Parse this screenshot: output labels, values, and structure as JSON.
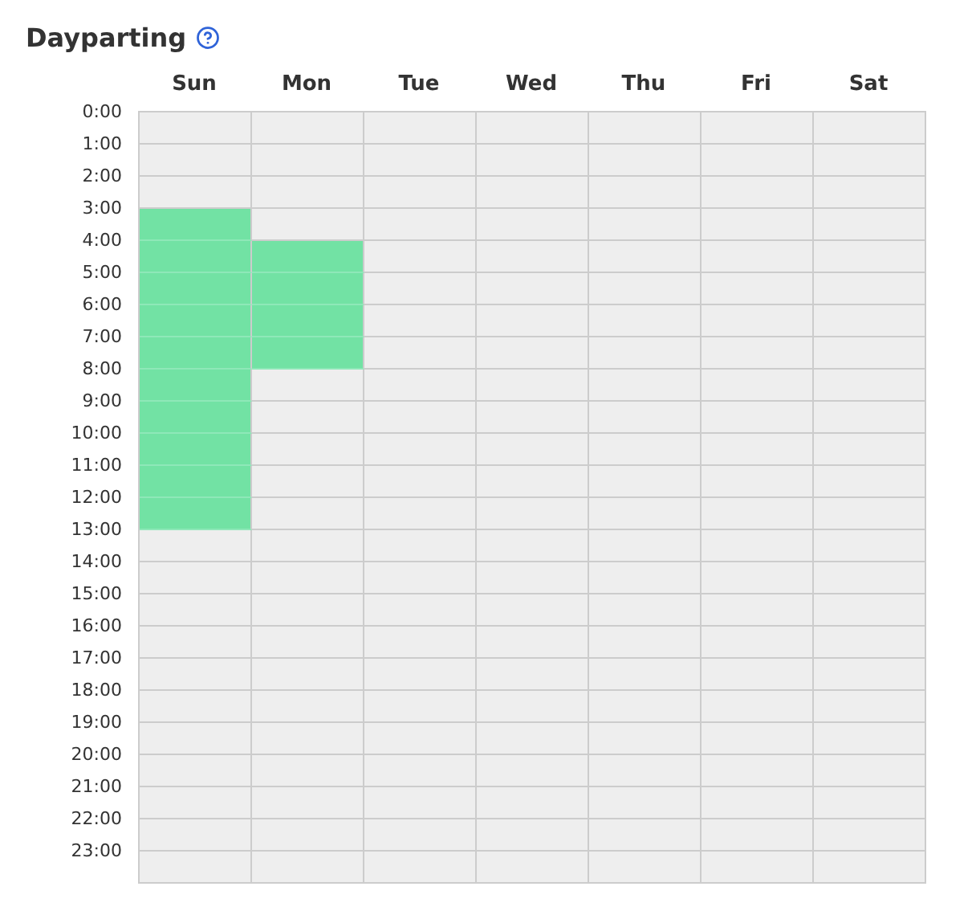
{
  "title": "Dayparting",
  "days": [
    "Sun",
    "Mon",
    "Tue",
    "Wed",
    "Thu",
    "Fri",
    "Sat"
  ],
  "hours": [
    {
      "label": "0:00",
      "slots": [
        false,
        false,
        false,
        false,
        false,
        false,
        false
      ]
    },
    {
      "label": "1:00",
      "slots": [
        false,
        false,
        false,
        false,
        false,
        false,
        false
      ]
    },
    {
      "label": "2:00",
      "slots": [
        false,
        false,
        false,
        false,
        false,
        false,
        false
      ]
    },
    {
      "label": "3:00",
      "slots": [
        true,
        false,
        false,
        false,
        false,
        false,
        false
      ]
    },
    {
      "label": "4:00",
      "slots": [
        true,
        true,
        false,
        false,
        false,
        false,
        false
      ]
    },
    {
      "label": "5:00",
      "slots": [
        true,
        true,
        false,
        false,
        false,
        false,
        false
      ]
    },
    {
      "label": "6:00",
      "slots": [
        true,
        true,
        false,
        false,
        false,
        false,
        false
      ]
    },
    {
      "label": "7:00",
      "slots": [
        true,
        true,
        false,
        false,
        false,
        false,
        false
      ]
    },
    {
      "label": "8:00",
      "slots": [
        true,
        false,
        false,
        false,
        false,
        false,
        false
      ]
    },
    {
      "label": "9:00",
      "slots": [
        true,
        false,
        false,
        false,
        false,
        false,
        false
      ]
    },
    {
      "label": "10:00",
      "slots": [
        true,
        false,
        false,
        false,
        false,
        false,
        false
      ]
    },
    {
      "label": "11:00",
      "slots": [
        true,
        false,
        false,
        false,
        false,
        false,
        false
      ]
    },
    {
      "label": "12:00",
      "slots": [
        true,
        false,
        false,
        false,
        false,
        false,
        false
      ]
    },
    {
      "label": "13:00",
      "slots": [
        false,
        false,
        false,
        false,
        false,
        false,
        false
      ]
    },
    {
      "label": "14:00",
      "slots": [
        false,
        false,
        false,
        false,
        false,
        false,
        false
      ]
    },
    {
      "label": "15:00",
      "slots": [
        false,
        false,
        false,
        false,
        false,
        false,
        false
      ]
    },
    {
      "label": "16:00",
      "slots": [
        false,
        false,
        false,
        false,
        false,
        false,
        false
      ]
    },
    {
      "label": "17:00",
      "slots": [
        false,
        false,
        false,
        false,
        false,
        false,
        false
      ]
    },
    {
      "label": "18:00",
      "slots": [
        false,
        false,
        false,
        false,
        false,
        false,
        false
      ]
    },
    {
      "label": "19:00",
      "slots": [
        false,
        false,
        false,
        false,
        false,
        false,
        false
      ]
    },
    {
      "label": "20:00",
      "slots": [
        false,
        false,
        false,
        false,
        false,
        false,
        false
      ]
    },
    {
      "label": "21:00",
      "slots": [
        false,
        false,
        false,
        false,
        false,
        false,
        false
      ]
    },
    {
      "label": "22:00",
      "slots": [
        false,
        false,
        false,
        false,
        false,
        false,
        false
      ]
    },
    {
      "label": "23:00",
      "slots": [
        false,
        false,
        false,
        false,
        false,
        false,
        false
      ]
    }
  ]
}
